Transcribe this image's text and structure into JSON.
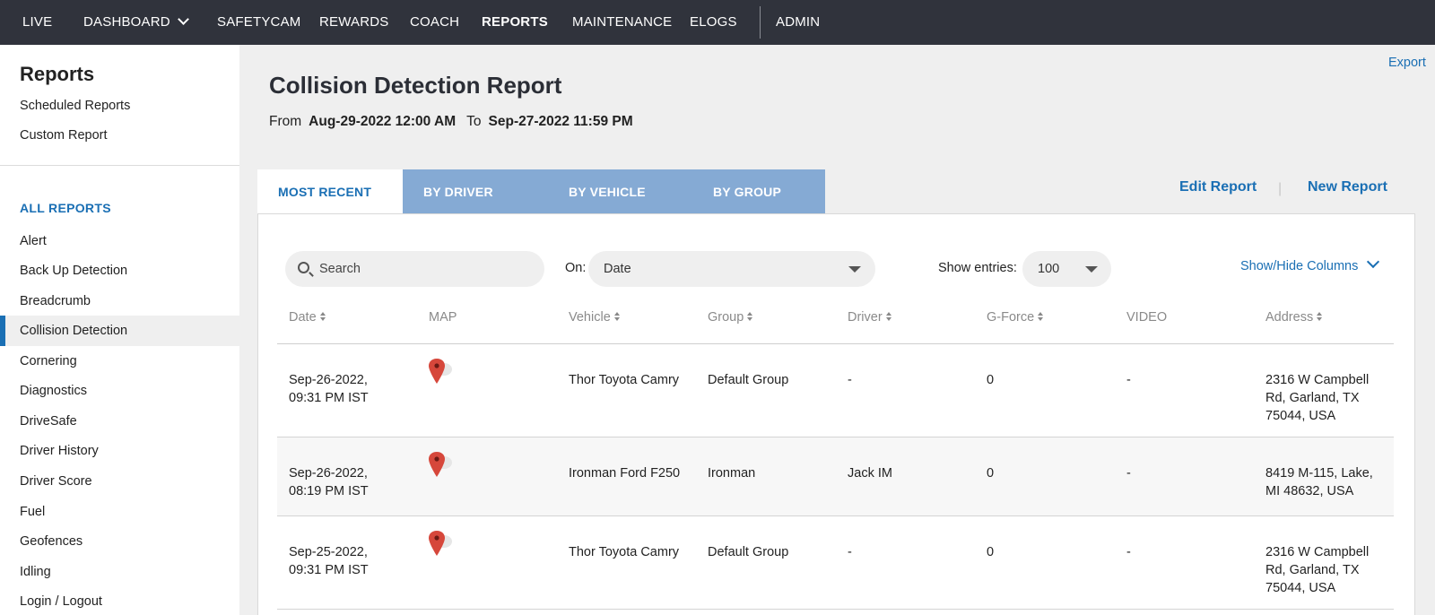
{
  "topnav": {
    "items": [
      {
        "label": "LIVE",
        "active": false
      },
      {
        "label": "DASHBOARD",
        "active": false,
        "dropdown": true
      },
      {
        "label": "SAFETYCAM",
        "active": false
      },
      {
        "label": "REWARDS",
        "active": false
      },
      {
        "label": "COACH",
        "active": false
      },
      {
        "label": "REPORTS",
        "active": true
      },
      {
        "label": "MAINTENANCE",
        "active": false
      },
      {
        "label": "ELOGS",
        "active": false
      },
      {
        "label": "ADMIN",
        "active": false
      }
    ]
  },
  "sidebar": {
    "title": "Reports",
    "links": [
      "Scheduled Reports",
      "Custom Report"
    ],
    "section_title": "ALL REPORTS",
    "items": [
      {
        "label": "Alert"
      },
      {
        "label": "Back Up Detection"
      },
      {
        "label": "Breadcrumb"
      },
      {
        "label": "Collision Detection",
        "active": true
      },
      {
        "label": "Cornering"
      },
      {
        "label": "Diagnostics"
      },
      {
        "label": "DriveSafe"
      },
      {
        "label": "Driver History"
      },
      {
        "label": "Driver Score"
      },
      {
        "label": "Fuel"
      },
      {
        "label": "Geofences"
      },
      {
        "label": "Idling"
      },
      {
        "label": "Login / Logout"
      }
    ]
  },
  "main": {
    "export_label": "Export",
    "title": "Collision Detection Report",
    "range": {
      "from_label": "From",
      "from_value": "Aug-29-2022 12:00 AM",
      "to_label": "To",
      "to_value": "Sep-27-2022 11:59 PM"
    },
    "tabs": [
      {
        "label": "MOST RECENT",
        "active": true
      },
      {
        "label": "BY DRIVER"
      },
      {
        "label": "BY VEHICLE"
      },
      {
        "label": "BY GROUP"
      }
    ],
    "edit_report_label": "Edit Report",
    "new_report_label": "New Report",
    "search_placeholder": "Search",
    "on_label": "On:",
    "on_value": "Date",
    "entries_label": "Show entries:",
    "entries_value": "100",
    "show_hide_label": "Show/Hide Columns",
    "columns": [
      {
        "label": "Date",
        "sortable": true
      },
      {
        "label": "MAP",
        "sortable": false
      },
      {
        "label": "Vehicle",
        "sortable": true
      },
      {
        "label": "Group",
        "sortable": true
      },
      {
        "label": "Driver",
        "sortable": true
      },
      {
        "label": "G-Force",
        "sortable": true
      },
      {
        "label": "VIDEO",
        "sortable": false
      },
      {
        "label": "Address",
        "sortable": true
      }
    ],
    "rows": [
      {
        "date_line1": "Sep-26-2022,",
        "date_line2": "09:31 PM IST",
        "vehicle": "Thor Toyota Camry",
        "group": "Default Group",
        "driver": "-",
        "gforce": "0",
        "video": "-",
        "address_line1": "2316 W Campbell",
        "address_line2": "Rd, Garland, TX",
        "address_line3": "75044, USA"
      },
      {
        "date_line1": "Sep-26-2022,",
        "date_line2": "08:19 PM IST",
        "vehicle": "Ironman Ford F250",
        "group": "Ironman",
        "driver": "Jack IM",
        "gforce": "0",
        "video": "-",
        "address_line1": "8419 M-115, Lake,",
        "address_line2": "MI 48632, USA",
        "address_line3": ""
      },
      {
        "date_line1": "Sep-25-2022,",
        "date_line2": "09:31 PM IST",
        "vehicle": "Thor Toyota Camry",
        "group": "Default Group",
        "driver": "-",
        "gforce": "0",
        "video": "-",
        "address_line1": "2316 W Campbell",
        "address_line2": "Rd, Garland, TX",
        "address_line3": "75044, USA"
      }
    ]
  },
  "colors": {
    "nav_bg": "#30333c",
    "accent": "#1a6fb4",
    "tab_inactive": "#85aad4",
    "pin_red": "#d6473b"
  }
}
